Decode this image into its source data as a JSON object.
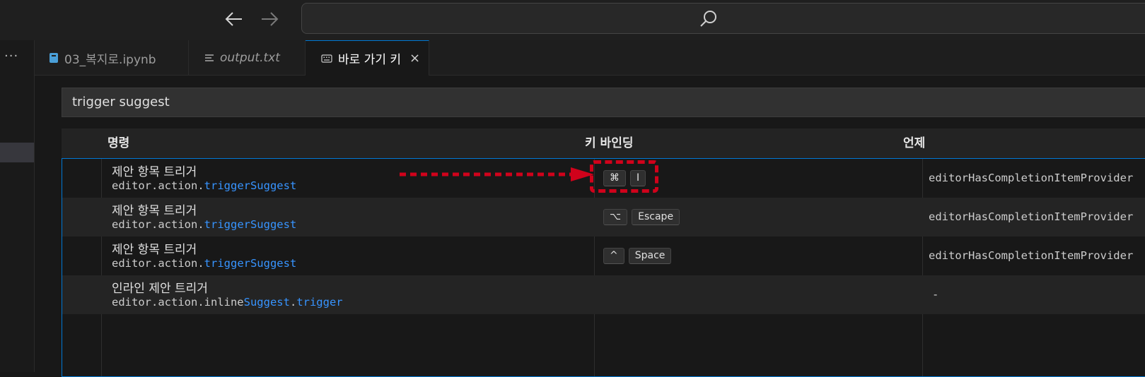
{
  "titlebar": {
    "back_icon": "arrow-left-icon",
    "forward_icon": "arrow-right-icon",
    "search_icon": "search-icon"
  },
  "sidebar": {
    "overflow_icon": "ellipsis-icon",
    "overflow_label": "···"
  },
  "tabs": [
    {
      "label": "03_복지로.ipynb",
      "icon": "notebook-icon",
      "active": false
    },
    {
      "label": "output.txt",
      "icon": "text-file-icon",
      "active": false
    },
    {
      "label": "바로 가기 키",
      "icon": "keyboard-icon",
      "active": true,
      "close": "×"
    }
  ],
  "filter": {
    "value": "trigger suggest"
  },
  "table": {
    "headers": {
      "command": "명령",
      "keybinding": "키 바인딩",
      "when": "언제"
    },
    "rows": [
      {
        "title": "제안 항목 트리거",
        "id_parts": [
          "editor.action.",
          "triggerSuggest"
        ],
        "keys": [
          "⌘",
          "I"
        ],
        "when": "editorHasCompletionItemProvider"
      },
      {
        "title": "제안 항목 트리거",
        "id_parts": [
          "editor.action.",
          "triggerSuggest"
        ],
        "keys": [
          "⌥",
          "Escape"
        ],
        "when": "editorHasCompletionItemProvider"
      },
      {
        "title": "제안 항목 트리거",
        "id_parts": [
          "editor.action.",
          "triggerSuggest"
        ],
        "keys": [
          "^",
          "Space"
        ],
        "when": "editorHasCompletionItemProvider"
      },
      {
        "title": "인라인 제안 트리거",
        "id_parts": [
          "editor.action.inline",
          "Suggest",
          ".",
          "trigger"
        ],
        "keys": [],
        "when": "-"
      }
    ]
  },
  "annotation": {
    "color": "#d0021b"
  },
  "colors": {
    "accent": "#0078d4",
    "highlight": "#3794ff",
    "annotation": "#d0021b"
  }
}
